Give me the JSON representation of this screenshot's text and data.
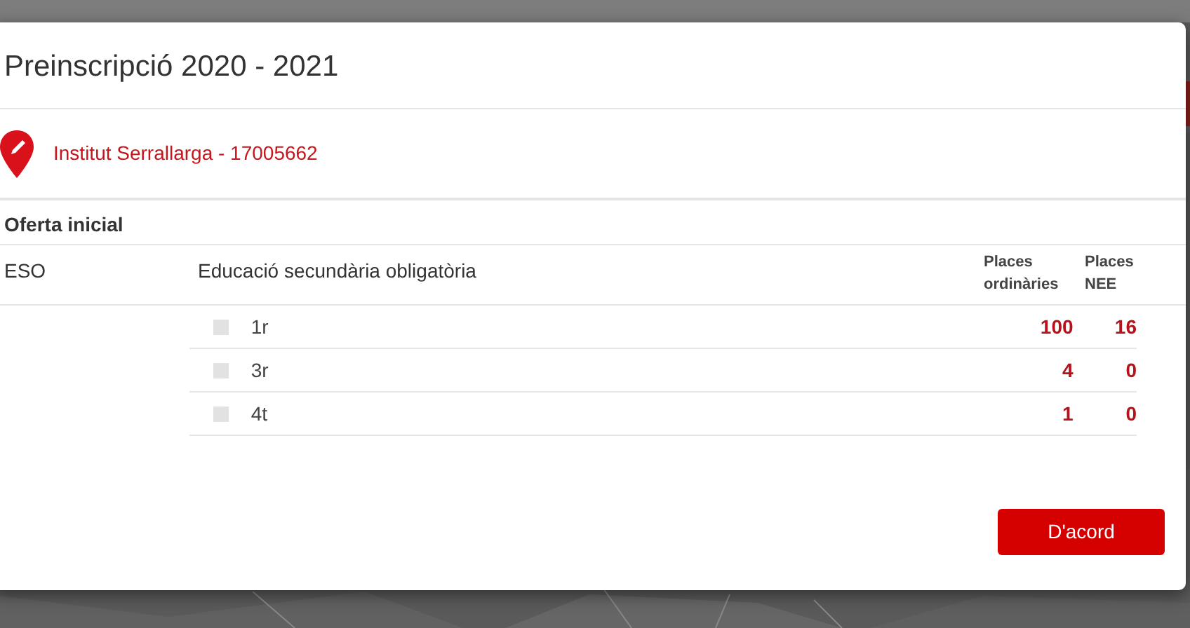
{
  "modal": {
    "title": "Preinscripció 2020 - 2021",
    "school": "Institut Serrallarga - 17005662",
    "section": "Oferta inicial",
    "offer": {
      "code": "ESO",
      "name": "Educació secundària obligatòria",
      "columns": [
        "Places ordinàries",
        "Places NEE"
      ],
      "rows": [
        {
          "course": "1r",
          "checked": false,
          "disabled": true,
          "ordinary": "100",
          "nee": "16"
        },
        {
          "course": "3r",
          "checked": false,
          "disabled": true,
          "ordinary": "4",
          "nee": "0"
        },
        {
          "course": "4t",
          "checked": false,
          "disabled": true,
          "ordinary": "1",
          "nee": "0"
        }
      ]
    },
    "button": "D'acord"
  }
}
